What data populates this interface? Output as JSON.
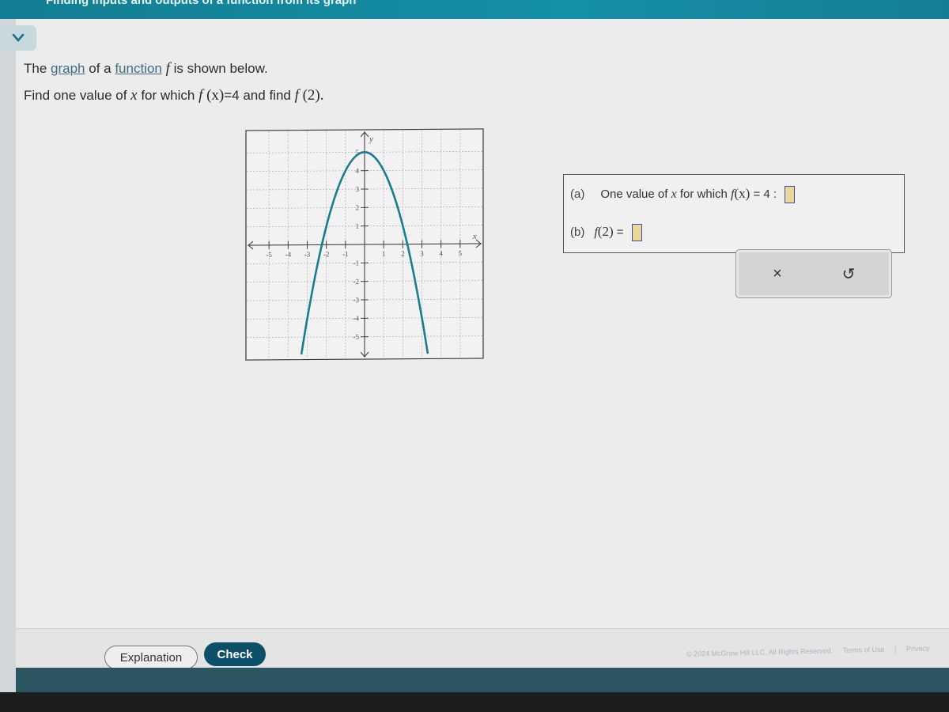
{
  "header": {
    "title": "Finding inputs and outputs of a function from its graph"
  },
  "question": {
    "line1_prefix": "The ",
    "line1_link1": "graph",
    "line1_mid": " of a ",
    "line1_link2": "function",
    "line1_var": "f",
    "line1_suffix": " is shown below.",
    "line2_prefix": "Find one value of ",
    "line2_var": "x",
    "line2_mid": " for which ",
    "line2_expr1": "f",
    "line2_expr1_arg": "(x)",
    "line2_eq": "=4 and find ",
    "line2_expr2": "f",
    "line2_expr2_arg": "(2)."
  },
  "answers": {
    "a_tag": "(a)",
    "a_text_prefix": "One value of ",
    "a_var": "x",
    "a_text_mid": " for which ",
    "a_expr": "f",
    "a_expr_arg": "(x)",
    "a_text_suffix": " = 4 :",
    "a_value": "",
    "b_tag": "(b)",
    "b_expr": "f",
    "b_expr_arg": "(2)",
    "b_text_suffix": " =",
    "b_value": ""
  },
  "controls": {
    "clear_icon": "×",
    "undo_icon": "↺"
  },
  "footer": {
    "explanation_label": "Explanation",
    "check_label": "Check",
    "copyright": "© 2024 McGraw Hill LLC. All Rights Reserved.",
    "terms": "Terms of Use",
    "separator": "|",
    "privacy": "Privacy"
  },
  "colors": {
    "curve": "#1a7d8f",
    "check_button": "#0d4f68",
    "header": "#1590a6"
  },
  "chart_data": {
    "type": "line",
    "title": "",
    "xlabel": "x",
    "ylabel": "y",
    "xlim": [
      -6,
      6
    ],
    "ylim": [
      -6,
      6
    ],
    "x_ticks": [
      -5,
      -4,
      -3,
      -2,
      -1,
      1,
      2,
      3,
      4,
      5
    ],
    "y_ticks": [
      -5,
      -4,
      -3,
      -2,
      -1,
      1,
      2,
      3,
      4,
      5
    ],
    "grid": true,
    "series": [
      {
        "name": "f",
        "description": "downward parabola, vertex (0,5)",
        "x": [
          -3.3,
          -3,
          -2.5,
          -2,
          -1.5,
          -1,
          -0.5,
          0,
          0.5,
          1,
          1.5,
          2,
          2.5,
          3,
          3.3
        ],
        "y": [
          -5.89,
          -4,
          -1.25,
          1,
          2.75,
          4,
          4.75,
          5,
          4.75,
          4,
          2.75,
          1,
          -1.25,
          -4,
          -5.89
        ]
      }
    ]
  }
}
